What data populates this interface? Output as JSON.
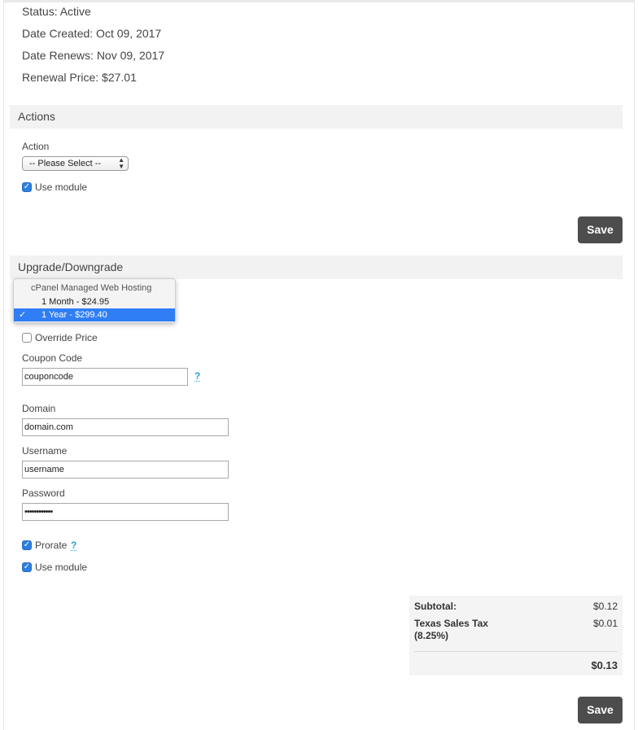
{
  "service_info": {
    "status": "Status: Active",
    "date_created": "Date Created: Oct 09, 2017",
    "date_renews": "Date Renews: Nov 09, 2017",
    "renewal_price": "Renewal Price: $27.01"
  },
  "actions": {
    "header": "Actions",
    "action_label": "Action",
    "action_select_value": "-- Please Select --",
    "use_module_label": "Use module",
    "save_label": "Save"
  },
  "upgrade": {
    "header": "Upgrade/Downgrade",
    "package_dropdown": {
      "group_label": "cPanel Managed Web Hosting",
      "options": [
        {
          "label": "1 Month - $24.95",
          "selected": false
        },
        {
          "label": "1 Year - $299.40",
          "selected": true
        }
      ]
    },
    "override_price_label": "Override Price",
    "coupon_label": "Coupon Code",
    "coupon_value": "couponcode",
    "domain_label": "Domain",
    "domain_value": "domain.com",
    "username_label": "Username",
    "username_value": "username",
    "password_label": "Password",
    "password_value": "••••••••••••",
    "prorate_label": "Prorate",
    "use_module_label": "Use module",
    "help_glyph": "?",
    "save_label": "Save"
  },
  "totals": {
    "subtotal_label": "Subtotal:",
    "subtotal_value": "$0.12",
    "tax_label_line1": "Texas Sales Tax",
    "tax_label_line2": "(8.25%)",
    "tax_value": "$0.01",
    "total_value": "$0.13"
  },
  "icons": {
    "checkmark": "✓",
    "select_arrows_up": "▲",
    "select_arrows_down": "▼"
  },
  "colors": {
    "accent_blue": "#2d7fe0",
    "save_button": "#4d4d4d",
    "help_link": "#2a9fd6",
    "selected_option": "#2f7ef5"
  }
}
